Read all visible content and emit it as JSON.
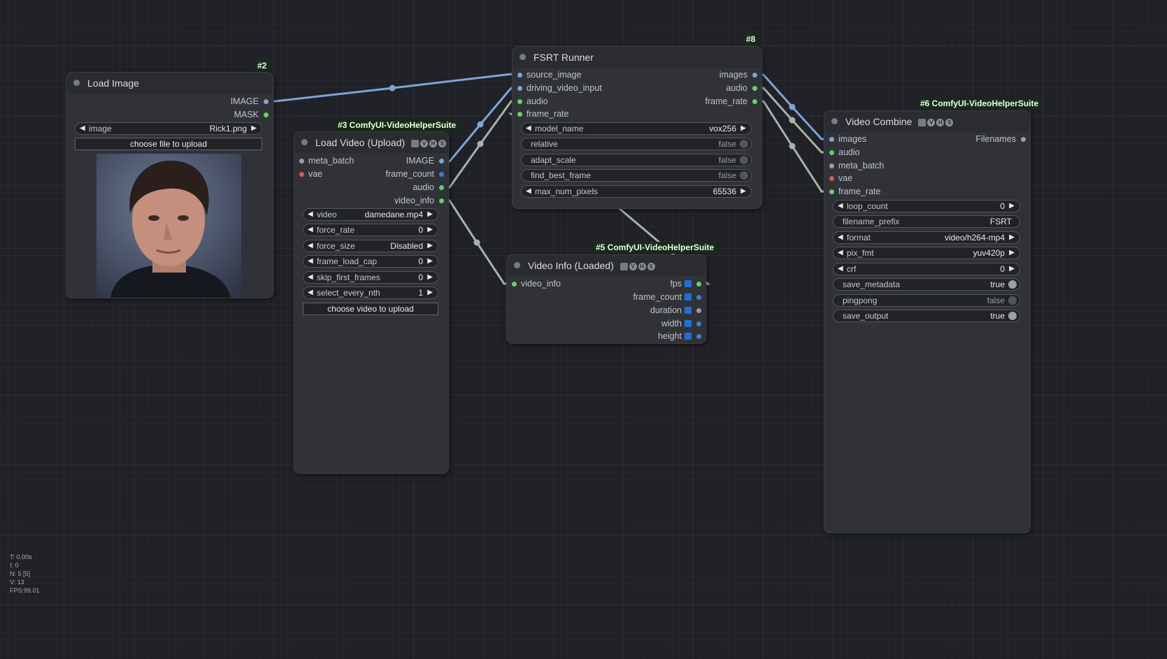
{
  "stats": [
    "T: 0.00s",
    "I: 0",
    "N: 5 [5]",
    "V: 13",
    "FPS:99.01"
  ],
  "nodes": {
    "load_image": {
      "badge": "#2",
      "title": "Load Image",
      "outputs": [
        "IMAGE",
        "MASK"
      ],
      "widget_image": {
        "label": "image",
        "value": "Rick1.png"
      },
      "upload_button": "choose file to upload",
      "preview": "portrait-photo"
    },
    "load_video": {
      "badge": "#3 ComfyUI-VideoHelperSuite",
      "title": "Load Video (Upload)",
      "inputs": [
        "meta_batch",
        "vae"
      ],
      "outputs": [
        "IMAGE",
        "frame_count",
        "audio",
        "video_info"
      ],
      "widgets": [
        {
          "label": "video",
          "value": "damedane.mp4"
        },
        {
          "label": "force_rate",
          "value": "0"
        },
        {
          "label": "force_size",
          "value": "Disabled"
        },
        {
          "label": "frame_load_cap",
          "value": "0"
        },
        {
          "label": "skip_first_frames",
          "value": "0"
        },
        {
          "label": "select_every_nth",
          "value": "1"
        }
      ],
      "upload_button": "choose video to upload"
    },
    "fsrt_runner": {
      "badge": "#8",
      "title": "FSRT Runner",
      "inputs": [
        "source_image",
        "driving_video_input",
        "audio",
        "frame_rate"
      ],
      "outputs": [
        "images",
        "audio",
        "frame_rate"
      ],
      "widgets": [
        {
          "label": "model_name",
          "value": "vox256"
        },
        {
          "label": "relative",
          "value": "false"
        },
        {
          "label": "adapt_scale",
          "value": "false"
        },
        {
          "label": "find_best_frame",
          "value": "false"
        },
        {
          "label": "max_num_pixels",
          "value": "65536"
        }
      ]
    },
    "video_info": {
      "badge": "#5 ComfyUI-VideoHelperSuite",
      "title": "Video Info (Loaded)",
      "inputs": [
        "video_info"
      ],
      "outputs": [
        "fps",
        "frame_count",
        "duration",
        "width",
        "height"
      ]
    },
    "video_combine": {
      "badge": "#6 ComfyUI-VideoHelperSuite",
      "title": "Video Combine",
      "inputs": [
        "images",
        "audio",
        "meta_batch",
        "vae",
        "frame_rate"
      ],
      "outputs": [
        "Filenames"
      ],
      "widgets": [
        {
          "label": "loop_count",
          "value": "0"
        },
        {
          "label": "filename_prefix",
          "value": "FSRT"
        },
        {
          "label": "format",
          "value": "video/h264-mp4"
        },
        {
          "label": "pix_fmt",
          "value": "yuv420p"
        },
        {
          "label": "crf",
          "value": "0"
        },
        {
          "label": "save_metadata",
          "value": "true"
        },
        {
          "label": "pingpong",
          "value": "false"
        },
        {
          "label": "save_output",
          "value": "true"
        }
      ]
    }
  },
  "colors": {
    "image_wire": "#7fa4d4",
    "audio_wire": "#a6b3a6",
    "pin_image": "#7fa4d4",
    "pin_green": "#65d165",
    "pin_red": "#d45a5a",
    "pin_gray": "#9a9ea6",
    "pin_blue": "#3f7fd0"
  }
}
